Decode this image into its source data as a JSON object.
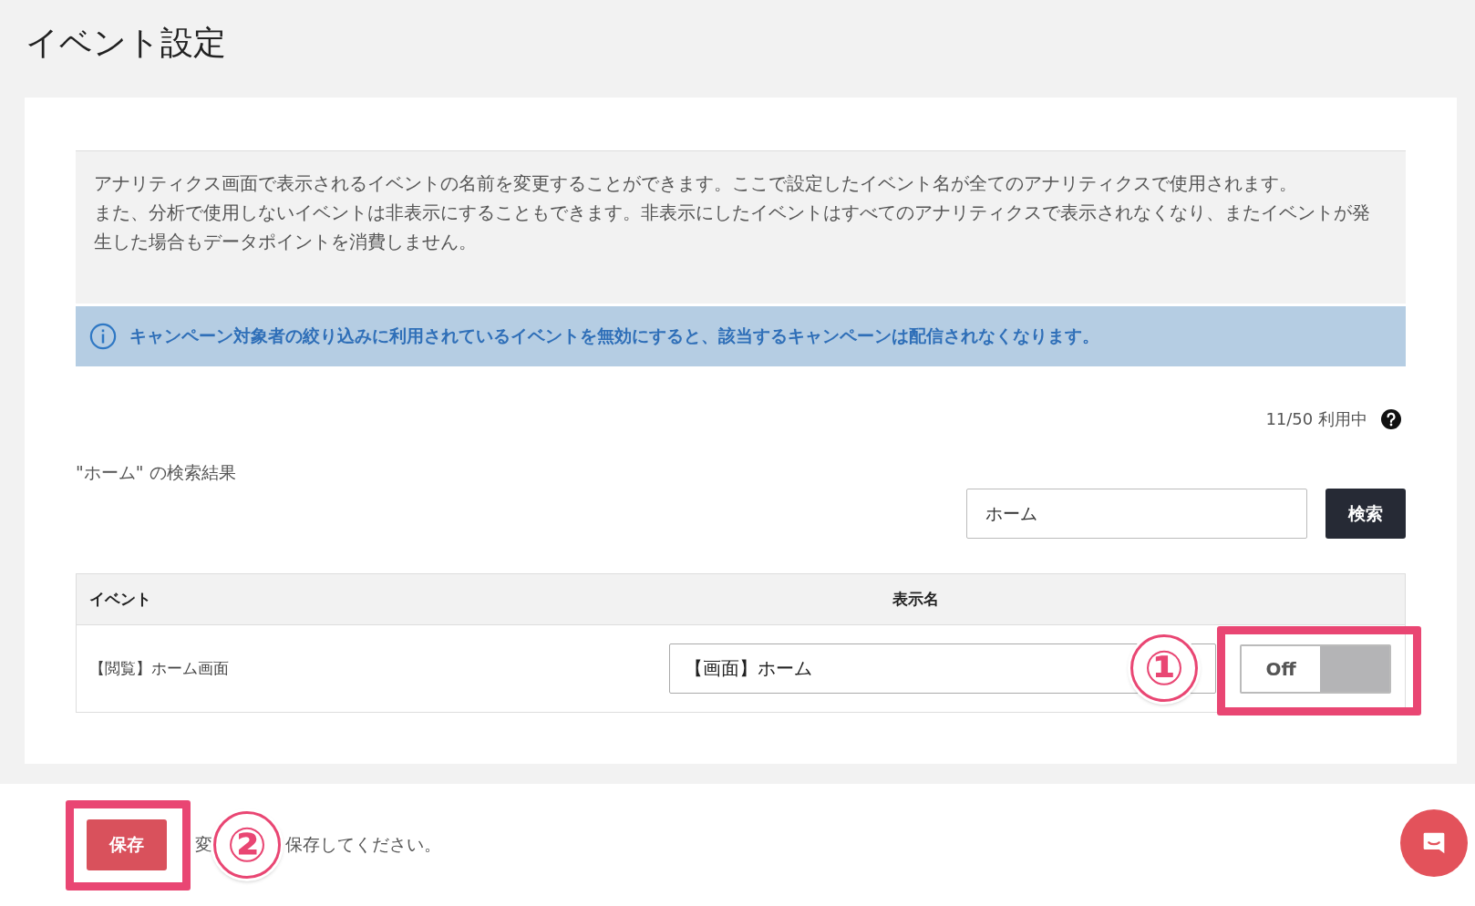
{
  "page_title": "イベント設定",
  "description": [
    "アナリティクス画面で表示されるイベントの名前を変更することができます。ここで設定したイベント名が全てのアナリティクスで使用されます。",
    "また、分析で使用しないイベントは非表示にすることもできます。非表示にしたイベントはすべてのアナリティクスで表示されなくなり、またイベントが発生した場合もデータポイントを消費しません。"
  ],
  "notice": "キャンペーン対象者の絞り込みに利用されているイベントを無効にすると、該当するキャンペーンは配信されなくなります。",
  "usage": "11/50 利用中",
  "search_result_label": "\"ホーム\" の検索結果",
  "search": {
    "value": "ホーム",
    "button": "検索"
  },
  "table": {
    "columns": [
      "イベント",
      "表示名"
    ],
    "rows": [
      {
        "event": "【閲覧】ホーム画面",
        "display_name": "【画面】ホーム",
        "toggle": {
          "label": "Off",
          "on": false
        }
      }
    ]
  },
  "footer": {
    "save_button": "保存",
    "hint_start": "変",
    "hint_end": "保存してください。"
  },
  "annotations": [
    {
      "label": "①"
    },
    {
      "label": "②"
    }
  ]
}
